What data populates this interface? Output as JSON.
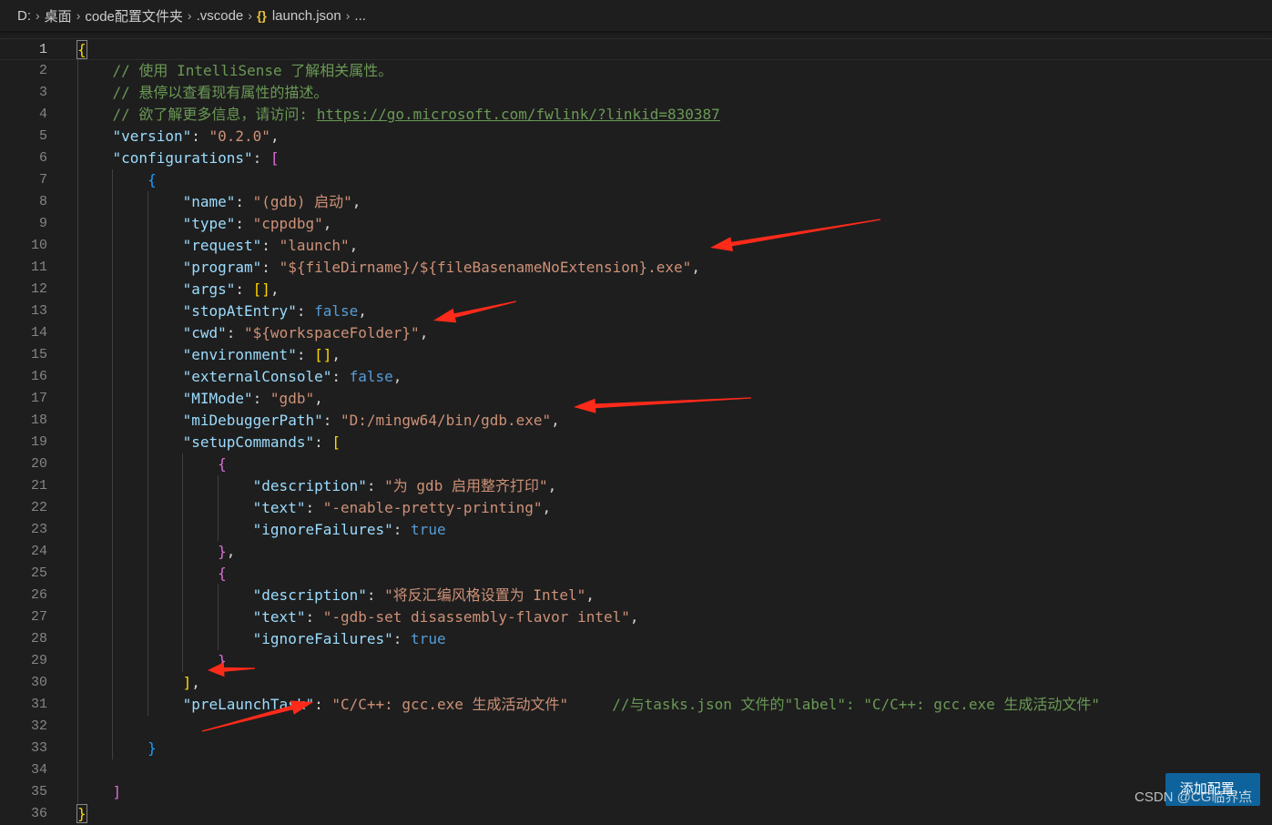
{
  "breadcrumb": {
    "items": [
      "D:",
      "桌面",
      "code配置文件夹",
      ".vscode",
      "launch.json",
      "..."
    ],
    "file_icon": "json-curly-braces-icon"
  },
  "editor": {
    "line_numbers": [
      "1",
      "2",
      "3",
      "4",
      "5",
      "6",
      "7",
      "8",
      "9",
      "10",
      "11",
      "12",
      "13",
      "14",
      "15",
      "16",
      "17",
      "18",
      "19",
      "20",
      "21",
      "22",
      "23",
      "24",
      "25",
      "26",
      "27",
      "28",
      "29",
      "30",
      "31",
      "32",
      "33",
      "34",
      "35",
      "36"
    ],
    "current_line": "1",
    "lines": [
      "{",
      "    // 使用 IntelliSense 了解相关属性。",
      "    // 悬停以查看现有属性的描述。",
      "    // 欲了解更多信息，请访问: https://go.microsoft.com/fwlink/?linkid=830387",
      "    \"version\": \"0.2.0\",",
      "    \"configurations\": [",
      "        {",
      "            \"name\": \"(gdb) 启动\",",
      "            \"type\": \"cppdbg\",",
      "            \"request\": \"launch\",",
      "            \"program\": \"${fileDirname}/${fileBasenameNoExtension}.exe\",",
      "            \"args\": [],",
      "            \"stopAtEntry\": false,",
      "            \"cwd\": \"${workspaceFolder}\",",
      "            \"environment\": [],",
      "            \"externalConsole\": false,",
      "            \"MIMode\": \"gdb\",",
      "            \"miDebuggerPath\": \"D:/mingw64/bin/gdb.exe\",",
      "            \"setupCommands\": [",
      "                {",
      "                    \"description\": \"为 gdb 启用整齐打印\",",
      "                    \"text\": \"-enable-pretty-printing\",",
      "                    \"ignoreFailures\": true",
      "                },",
      "                {",
      "                    \"description\": \"将反汇编风格设置为 Intel\",",
      "                    \"text\": \"-gdb-set disassembly-flavor intel\",",
      "                    \"ignoreFailures\": true",
      "                }",
      "            ],",
      "            \"preLaunchTask\": \"C/C++: gcc.exe 生成活动文件\"     //与tasks.json 文件的\"label\": \"C/C++: gcc.exe 生成活动文件\"",
      "",
      "        }",
      "",
      "    ]",
      "}"
    ]
  },
  "add_config_button": {
    "label": "添加配置..."
  },
  "watermark": "CSDN @CG临界点",
  "annotations": {
    "arrow_color": "#ff2a1a",
    "arrow_count": 6
  },
  "colors": {
    "background": "#1e1e1e",
    "key": "#9cdcfe",
    "string": "#ce9178",
    "comment": "#6a9955",
    "keyword": "#569cd6",
    "bracket_level_1": "#ffd700",
    "bracket_level_2": "#da70d6",
    "bracket_level_3": "#179fff",
    "button": "#0e639c"
  }
}
